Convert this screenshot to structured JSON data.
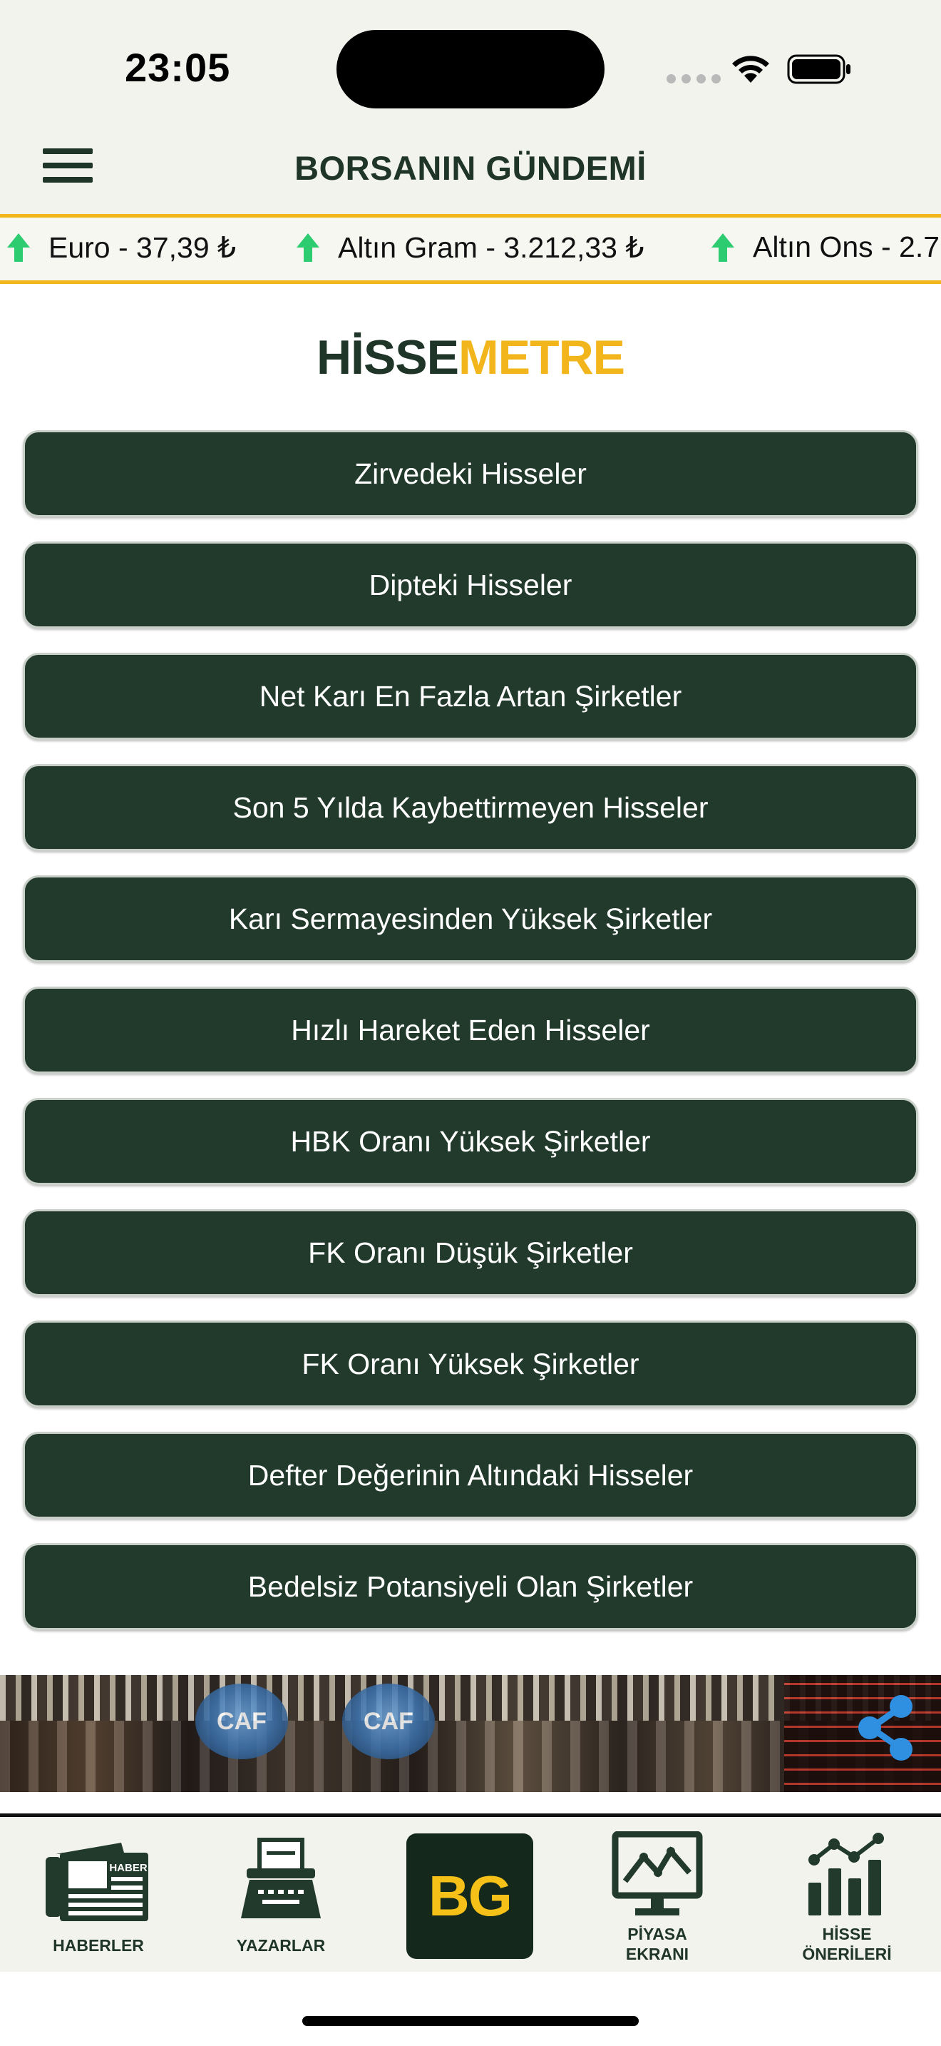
{
  "status_bar": {
    "time": "23:05"
  },
  "header": {
    "title": "BORSANIN GÜNDEMİ"
  },
  "ticker": {
    "items": [
      {
        "label": "Euro - 37,39 ₺",
        "direction": "up"
      },
      {
        "label": "Altın Gram - 3.212,33 ₺",
        "direction": "up"
      },
      {
        "label": "Altın Ons - 2.7",
        "direction": "up"
      }
    ]
  },
  "brand": {
    "part1": "HİSSE",
    "part2": "METRE"
  },
  "buttons": [
    "Zirvedeki Hisseler",
    "Dipteki Hisseler",
    "Net Karı En Fazla Artan Şirketler",
    "Son 5 Yılda Kaybettirmeyen Hisseler",
    "Karı Sermayesinden Yüksek Şirketler",
    "Hızlı Hareket Eden Hisseler",
    "HBK Oranı Yüksek Şirketler",
    "FK Oranı Düşük Şirketler",
    "FK Oranı Yüksek Şirketler",
    "Defter Değerinin Altındaki Hisseler",
    "Bedelsiz Potansiyeli Olan Şirketler"
  ],
  "banner": {
    "logo_text": "CAF"
  },
  "tabbar": {
    "haberler": {
      "label": "HABERLER",
      "icon_text": "HABER"
    },
    "yazarlar": {
      "label": "YAZARLAR"
    },
    "center_logo": "BG",
    "piyasa": {
      "label_line1": "PİYASA",
      "label_line2": "EKRANI"
    },
    "hisse": {
      "label_line1": "HİSSE",
      "label_line2": "ÖNERİLERİ"
    }
  },
  "colors": {
    "primary_green": "#223a2c",
    "accent_yellow": "#f2b51b",
    "up_arrow": "#2ecc71",
    "share_blue": "#2f8fe0"
  }
}
